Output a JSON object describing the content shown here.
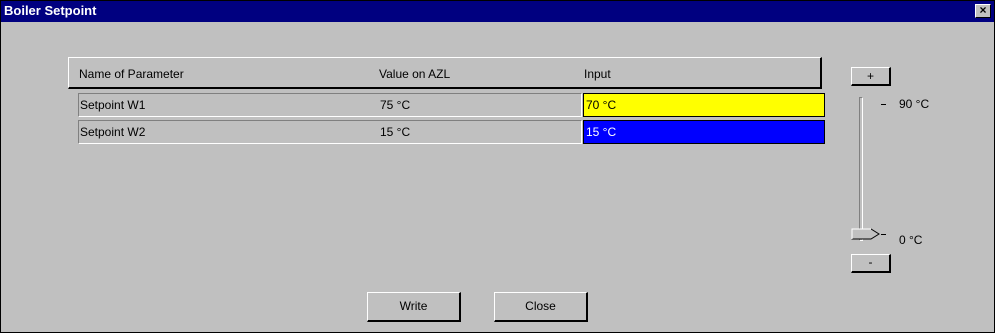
{
  "window": {
    "title": "Boiler Setpoint",
    "close_label": "×"
  },
  "table": {
    "headers": [
      "Name of Parameter",
      "Value on AZL",
      "Input"
    ],
    "rows": [
      {
        "name": "Setpoint W1",
        "value": "75 °C",
        "input": "70 °C"
      },
      {
        "name": "Setpoint W2",
        "value": "15 °C",
        "input": "15 °C"
      }
    ]
  },
  "slider": {
    "plus_label": "+",
    "minus_label": "-",
    "max_label": "90 °C",
    "min_label": "0 °C",
    "level": 0.05
  },
  "buttons": {
    "write_label": "Write",
    "close_label": "Close"
  },
  "colors": {
    "title_bar": "#000080",
    "input_highlight": "#ffff00",
    "input_selected": "#0000ff"
  }
}
